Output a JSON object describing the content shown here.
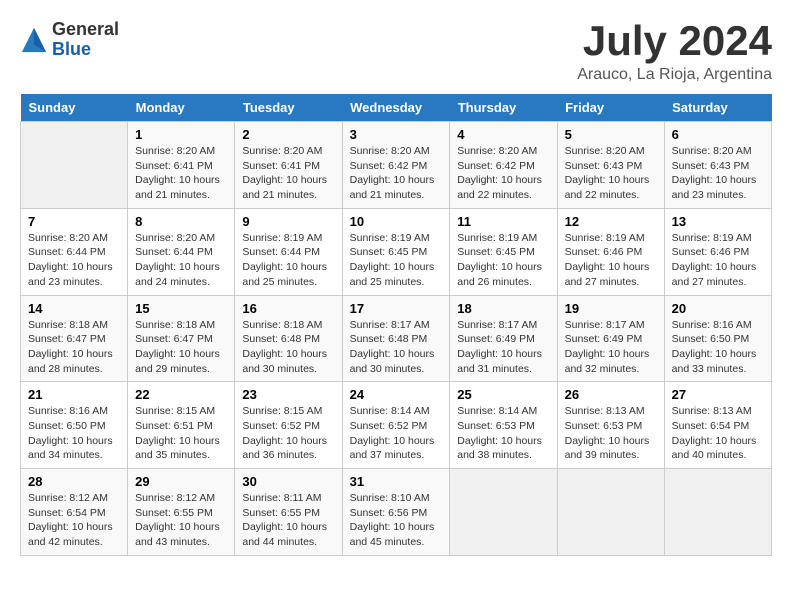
{
  "header": {
    "logo_general": "General",
    "logo_blue": "Blue",
    "title": "July 2024",
    "subtitle": "Arauco, La Rioja, Argentina"
  },
  "calendar": {
    "days_of_week": [
      "Sunday",
      "Monday",
      "Tuesday",
      "Wednesday",
      "Thursday",
      "Friday",
      "Saturday"
    ],
    "weeks": [
      [
        {
          "day": "",
          "info": ""
        },
        {
          "day": "1",
          "info": "Sunrise: 8:20 AM\nSunset: 6:41 PM\nDaylight: 10 hours\nand 21 minutes."
        },
        {
          "day": "2",
          "info": "Sunrise: 8:20 AM\nSunset: 6:41 PM\nDaylight: 10 hours\nand 21 minutes."
        },
        {
          "day": "3",
          "info": "Sunrise: 8:20 AM\nSunset: 6:42 PM\nDaylight: 10 hours\nand 21 minutes."
        },
        {
          "day": "4",
          "info": "Sunrise: 8:20 AM\nSunset: 6:42 PM\nDaylight: 10 hours\nand 22 minutes."
        },
        {
          "day": "5",
          "info": "Sunrise: 8:20 AM\nSunset: 6:43 PM\nDaylight: 10 hours\nand 22 minutes."
        },
        {
          "day": "6",
          "info": "Sunrise: 8:20 AM\nSunset: 6:43 PM\nDaylight: 10 hours\nand 23 minutes."
        }
      ],
      [
        {
          "day": "7",
          "info": "Sunrise: 8:20 AM\nSunset: 6:44 PM\nDaylight: 10 hours\nand 23 minutes."
        },
        {
          "day": "8",
          "info": "Sunrise: 8:20 AM\nSunset: 6:44 PM\nDaylight: 10 hours\nand 24 minutes."
        },
        {
          "day": "9",
          "info": "Sunrise: 8:19 AM\nSunset: 6:44 PM\nDaylight: 10 hours\nand 25 minutes."
        },
        {
          "day": "10",
          "info": "Sunrise: 8:19 AM\nSunset: 6:45 PM\nDaylight: 10 hours\nand 25 minutes."
        },
        {
          "day": "11",
          "info": "Sunrise: 8:19 AM\nSunset: 6:45 PM\nDaylight: 10 hours\nand 26 minutes."
        },
        {
          "day": "12",
          "info": "Sunrise: 8:19 AM\nSunset: 6:46 PM\nDaylight: 10 hours\nand 27 minutes."
        },
        {
          "day": "13",
          "info": "Sunrise: 8:19 AM\nSunset: 6:46 PM\nDaylight: 10 hours\nand 27 minutes."
        }
      ],
      [
        {
          "day": "14",
          "info": "Sunrise: 8:18 AM\nSunset: 6:47 PM\nDaylight: 10 hours\nand 28 minutes."
        },
        {
          "day": "15",
          "info": "Sunrise: 8:18 AM\nSunset: 6:47 PM\nDaylight: 10 hours\nand 29 minutes."
        },
        {
          "day": "16",
          "info": "Sunrise: 8:18 AM\nSunset: 6:48 PM\nDaylight: 10 hours\nand 30 minutes."
        },
        {
          "day": "17",
          "info": "Sunrise: 8:17 AM\nSunset: 6:48 PM\nDaylight: 10 hours\nand 30 minutes."
        },
        {
          "day": "18",
          "info": "Sunrise: 8:17 AM\nSunset: 6:49 PM\nDaylight: 10 hours\nand 31 minutes."
        },
        {
          "day": "19",
          "info": "Sunrise: 8:17 AM\nSunset: 6:49 PM\nDaylight: 10 hours\nand 32 minutes."
        },
        {
          "day": "20",
          "info": "Sunrise: 8:16 AM\nSunset: 6:50 PM\nDaylight: 10 hours\nand 33 minutes."
        }
      ],
      [
        {
          "day": "21",
          "info": "Sunrise: 8:16 AM\nSunset: 6:50 PM\nDaylight: 10 hours\nand 34 minutes."
        },
        {
          "day": "22",
          "info": "Sunrise: 8:15 AM\nSunset: 6:51 PM\nDaylight: 10 hours\nand 35 minutes."
        },
        {
          "day": "23",
          "info": "Sunrise: 8:15 AM\nSunset: 6:52 PM\nDaylight: 10 hours\nand 36 minutes."
        },
        {
          "day": "24",
          "info": "Sunrise: 8:14 AM\nSunset: 6:52 PM\nDaylight: 10 hours\nand 37 minutes."
        },
        {
          "day": "25",
          "info": "Sunrise: 8:14 AM\nSunset: 6:53 PM\nDaylight: 10 hours\nand 38 minutes."
        },
        {
          "day": "26",
          "info": "Sunrise: 8:13 AM\nSunset: 6:53 PM\nDaylight: 10 hours\nand 39 minutes."
        },
        {
          "day": "27",
          "info": "Sunrise: 8:13 AM\nSunset: 6:54 PM\nDaylight: 10 hours\nand 40 minutes."
        }
      ],
      [
        {
          "day": "28",
          "info": "Sunrise: 8:12 AM\nSunset: 6:54 PM\nDaylight: 10 hours\nand 42 minutes."
        },
        {
          "day": "29",
          "info": "Sunrise: 8:12 AM\nSunset: 6:55 PM\nDaylight: 10 hours\nand 43 minutes."
        },
        {
          "day": "30",
          "info": "Sunrise: 8:11 AM\nSunset: 6:55 PM\nDaylight: 10 hours\nand 44 minutes."
        },
        {
          "day": "31",
          "info": "Sunrise: 8:10 AM\nSunset: 6:56 PM\nDaylight: 10 hours\nand 45 minutes."
        },
        {
          "day": "",
          "info": ""
        },
        {
          "day": "",
          "info": ""
        },
        {
          "day": "",
          "info": ""
        }
      ]
    ]
  }
}
